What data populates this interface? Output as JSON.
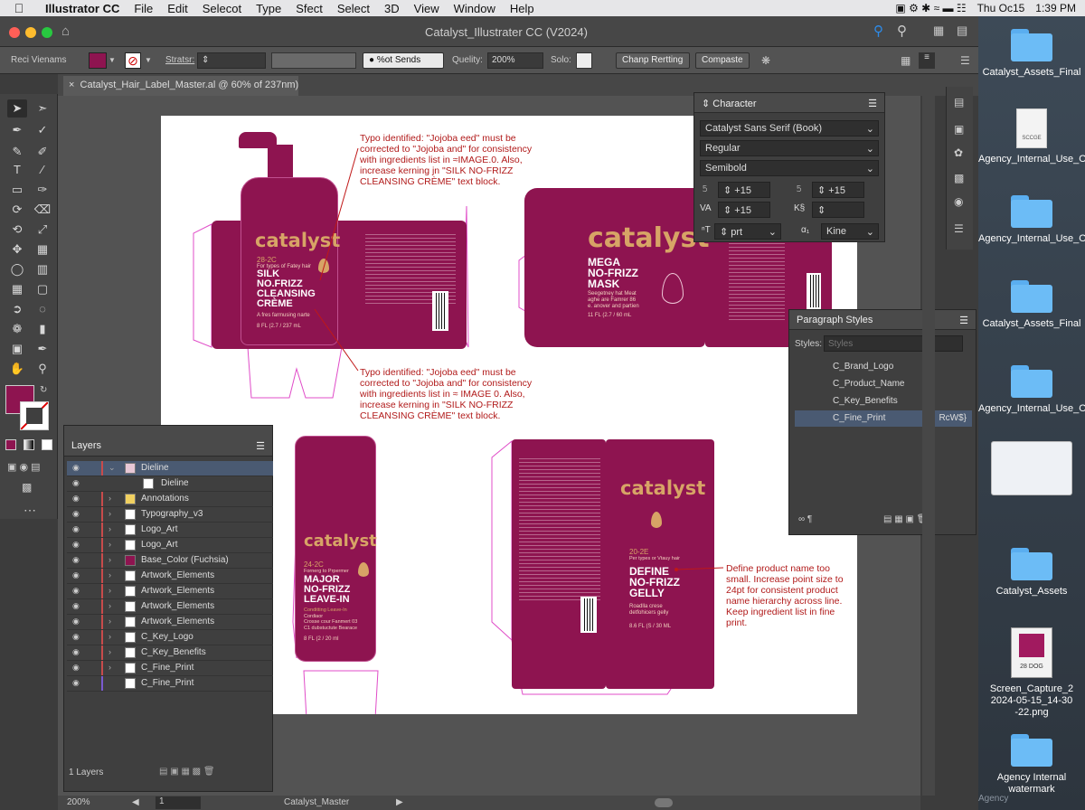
{
  "menubar": {
    "app": "Illustrator CC",
    "items": [
      "File",
      "Edit",
      "Selecot",
      "Type",
      "Sfect",
      "Select",
      "3D",
      "View",
      "Window",
      "Help"
    ],
    "clock": "Thu Oc15",
    "time": "1:39 PM"
  },
  "window": {
    "title": "Catalyst_Illustrater CC (V2024)"
  },
  "controlbar": {
    "panel_label": "Reci Vienams",
    "stroke_label": "Stratsr:",
    "opacity_label": "%ot Sends",
    "quality_label": "Quelity:",
    "quality_value": "200%",
    "solo_label": "Solo:",
    "btn1": "Chanp Rertting",
    "btn2": "Compaste"
  },
  "document": {
    "tab": "Catalyst_Hair_Label_Master.al @ 60% of 237nm)"
  },
  "labels": {
    "creme": {
      "brand": "catalyst",
      "sub1": "28-2C",
      "sub2": "For types of Fatey hair",
      "name1": "SILK",
      "name2": "NO.FRIZZ",
      "name3": "CLEANSING",
      "name4": "CRÈME",
      "tag": "A fres farmusing narte",
      "size": "8 FL (2.7 / 237 mL"
    },
    "mask": {
      "brand": "catalyst",
      "name1": "MEGA",
      "name2": "NO-FRIZZ",
      "name3": "MASK",
      "tag": "Seegetney hat Meat",
      "tag2": "aghe are Famrer 86",
      "tag3": "e. anover and partien",
      "size": "11 FL (2.7 / 60 mL"
    },
    "leavein": {
      "brand": "catalyst",
      "sub1": "24-2C",
      "sub2": "Fornerg to Prpermer",
      "name1": "MAJOR",
      "name2": "NO-FRIZZ",
      "name3": "LEAVE-IN",
      "tag": "Conditting Leave-In",
      "tag2": "Cordiaor",
      "tag3": "Crosse cour Fanmert 03",
      "tag4": "C1 dubstuctute Bearace",
      "size": "8 FL (2 / 20 ml"
    },
    "gelly": {
      "brand": "catalyst",
      "sub1": "20-2E",
      "sub2": "Per types or Vtauy hair",
      "name1": "DEFINE",
      "name2": "NO-FRIZZ",
      "name3": "GELLY",
      "tag": "Roadlla crese",
      "tag2": "detfohicers gelly",
      "size": "8.6 FL (S / 30 ML"
    }
  },
  "annotations": {
    "a1": "Typo identified: \"Jojoba eed\" must be corrected to \"Jojoba and\" for consistency with ingredients list in ≈IMAGE.0.  Also, increase kerning jn \"SILK NO-FRIZZ CLEANSING CRÈME\" text block.",
    "a2": "Typo identified: \"Jojoba eed\" must be corrected to \"Jojoba and\" for consistency with ingredients list in ≈ IMAGE 0. Also, increase kerning in \"SILK NO-FRIZZ CLEANSING CRÈME\" text block.",
    "a3": "Define product name too small. Increase point size to 24pt for consistent product name hierarchy across line. Keep ingredient list in fine print."
  },
  "character": {
    "title": "Character",
    "font": "Catalyst Sans Serif (Book)",
    "style": "Regular",
    "weight": "Semibold",
    "size": "+15",
    "leading": "+15",
    "kern": "+15",
    "unit": "prt",
    "lang": "Kine"
  },
  "paragraph": {
    "title": "Paragraph Styles",
    "styles_label": "Styles:",
    "styles_placeholder": "Styles",
    "items": [
      "C_Brand_Logo",
      "C_Product_Name",
      "C_Key_Benefits",
      "C_Fine_Print"
    ],
    "shortcut": "RcW$}"
  },
  "layers": {
    "title": "Layers",
    "footer": "1 Layers",
    "rows": [
      "Dieline",
      "Dieline",
      "Annotations",
      "Typography_v3",
      "Logo_Art",
      "Logo_Art",
      "Base_Color (Fuchsia)",
      "Artwork_Elements",
      "Artwork_Elements",
      "Artwork_Elements",
      "Artwork_Elements",
      "C_Key_Logo",
      "C_Key_Benefits",
      "C_Fine_Print",
      "C_Fine_Print"
    ]
  },
  "status": {
    "zoom": "200%",
    "page": "1",
    "artboard": "Catalyst_Master"
  },
  "desktop": {
    "items": [
      "Catalyst_Assets_Final",
      "Agency_Internal_Use_Only",
      "Agency_Internal_Use_Only",
      "Catalyst_Assets_Final",
      "Agency_Internal_Use_Only",
      "Catalyst_Assets",
      "Screen_Capture_2 2024-05-15_14-30 -22.png",
      "Agency Internal watermark"
    ],
    "doc_caption": "SCCGE",
    "png_caption": "28 DOG",
    "watermark_prefix": "Agency"
  },
  "colors": {
    "fuchsia": "#8e1450",
    "gold": "#d7a466",
    "annotation": "#b11a1a"
  }
}
